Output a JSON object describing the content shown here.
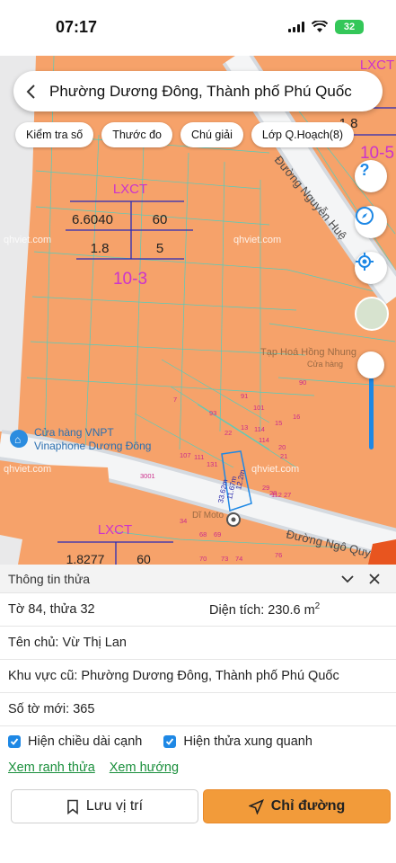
{
  "status_bar": {
    "time": "07:17",
    "battery": "32"
  },
  "header": {
    "location_title": "Phường Dương Đông, Thành phố Phú Quốc"
  },
  "chips": [
    {
      "label": "Kiểm tra số"
    },
    {
      "label": "Thước đo"
    },
    {
      "label": "Chú giải"
    },
    {
      "label": "Lớp Q.Hoạch(8)"
    }
  ],
  "map": {
    "zone_label": "LXCT",
    "zone_main": {
      "area_code": "6.6040",
      "height": "60",
      "ratio": "1.8",
      "floors": "5",
      "block": "10-3"
    },
    "zone_lower": {
      "code": "LXCT",
      "area_code": "1.8277",
      "height": "60"
    },
    "zone_topright": {
      "code": "LXCT",
      "ratio": "1.8",
      "block": "10-5"
    },
    "roads": [
      "Đường Nguyễn Huệ",
      "Đường Ngô Quyền"
    ],
    "watermark": "qhviet.com",
    "pois": [
      "Cửa hàng VNPT",
      "Vinaphone Dương Đông",
      "Tạp Hoá Hồng Nhung",
      "Cửa hàng",
      "Dĩ Moto"
    ],
    "parcel_numbers": [
      "7",
      "91",
      "101",
      "90",
      "93",
      "15",
      "16",
      "13",
      "114",
      "114",
      "22",
      "20",
      "21",
      "107",
      "111",
      "131",
      "3001",
      "34",
      "68",
      "69",
      "70",
      "73",
      "74",
      "76",
      "29",
      "28",
      "112",
      "27"
    ],
    "measure_labels": [
      "33.62m",
      "11.67m",
      "12.2m"
    ]
  },
  "panel": {
    "title": "Thông tin thửa",
    "sheet_parcel": "Tờ 84, thửa 32",
    "area_label": "Diện tích: 230.6 m",
    "area_sup": "2",
    "owner": "Tên chủ: Vừ Thị Lan",
    "old_area": "Khu vực cũ: Phường Dương Đông, Thành phố Phú Quốc",
    "new_sheet": "Số tờ mới: 365",
    "check_edges": "Hiện chiều dài cạnh",
    "check_neighbors": "Hiện thửa xung quanh",
    "link_outline": "Xem ranh thửa",
    "link_direction": "Xem hướng",
    "btn_save": "Lưu vị trí",
    "btn_route": "Chỉ đường"
  },
  "colors": {
    "map_orange": "#f6a26a",
    "accent_blue": "#1e88e5",
    "route_orange": "#f29b3a",
    "zone_purple": "#cc33cc"
  }
}
